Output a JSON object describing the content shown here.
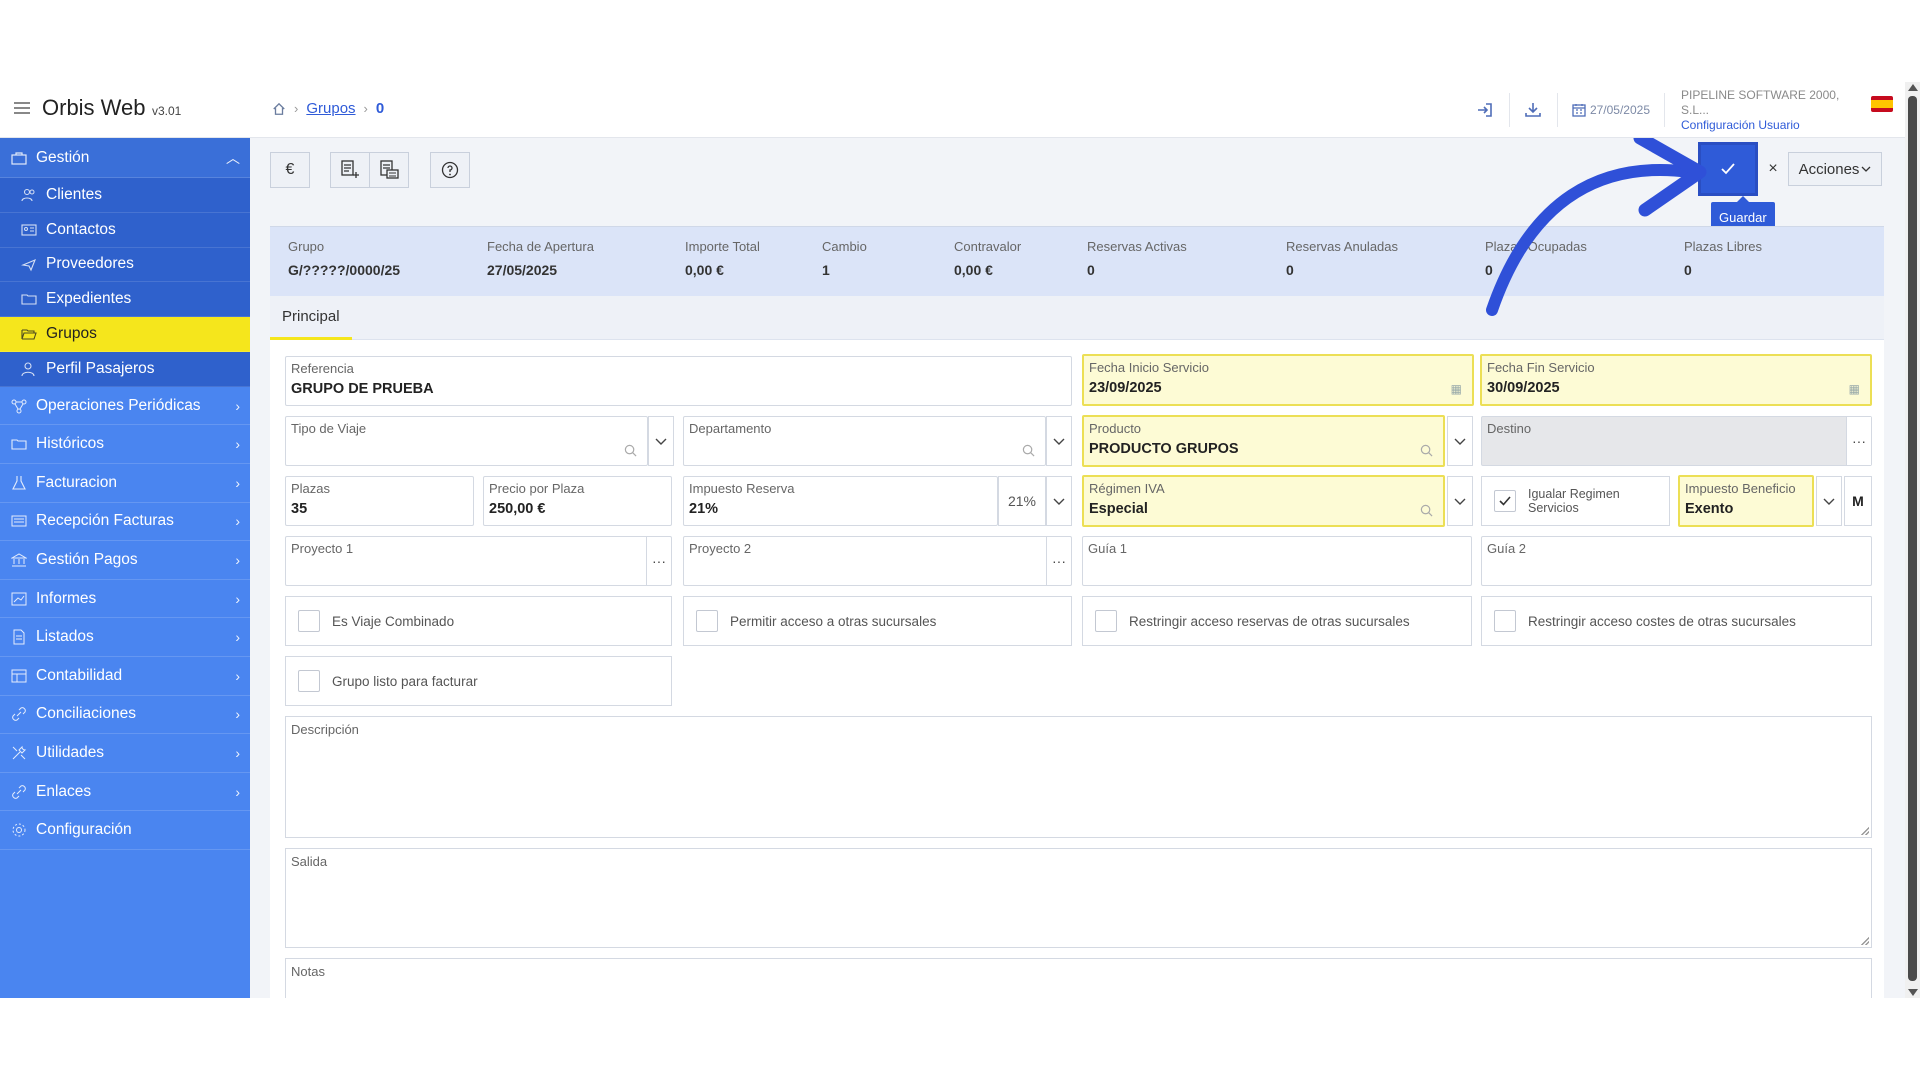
{
  "app": {
    "title": "Orbis Web",
    "version": "v3.01"
  },
  "breadcrumb": {
    "link": "Grupos",
    "current": "0"
  },
  "header": {
    "date": "27/05/2025",
    "company": "PIPELINE SOFTWARE 2000, S.L...",
    "config_link": "Configuración Usuario"
  },
  "sidebar": {
    "section": "Gestión",
    "sub_items": [
      "Clientes",
      "Contactos",
      "Proveedores",
      "Expedientes",
      "Grupos",
      "Perfil Pasajeros"
    ],
    "items": [
      "Operaciones Periódicas",
      "Históricos",
      "Facturacion",
      "Recepción Facturas",
      "Gestión Pagos",
      "Informes",
      "Listados",
      "Contabilidad",
      "Conciliaciones",
      "Utilidades",
      "Enlaces",
      "Configuración"
    ]
  },
  "toolbar": {
    "euro": "€",
    "acciones": "Acciones",
    "close": "×",
    "tooltip": "Guardar"
  },
  "summary": [
    {
      "label": "Grupo",
      "value": "G/?????/0000/25"
    },
    {
      "label": "Fecha de Apertura",
      "value": "27/05/2025"
    },
    {
      "label": "Importe Total",
      "value": "0,00 €"
    },
    {
      "label": "Cambio",
      "value": "1"
    },
    {
      "label": "Contravalor",
      "value": "0,00 €"
    },
    {
      "label": "Reservas Activas",
      "value": "0"
    },
    {
      "label": "Reservas Anuladas",
      "value": "0"
    },
    {
      "label": "Plazas Ocupadas",
      "value": "0"
    },
    {
      "label": "Plazas Libres",
      "value": "0"
    }
  ],
  "tabs": {
    "principal": "Principal"
  },
  "form": {
    "referencia": {
      "label": "Referencia",
      "value": "GRUPO DE PRUEBA"
    },
    "fecha_inicio": {
      "label": "Fecha Inicio Servicio",
      "value": "23/09/2025"
    },
    "fecha_fin": {
      "label": "Fecha Fin Servicio",
      "value": "30/09/2025"
    },
    "tipo_viaje": {
      "label": "Tipo de Viaje",
      "value": ""
    },
    "departamento": {
      "label": "Departamento",
      "value": ""
    },
    "producto": {
      "label": "Producto",
      "value": "PRODUCTO GRUPOS"
    },
    "destino": {
      "label": "Destino",
      "value": ""
    },
    "plazas": {
      "label": "Plazas",
      "value": "35"
    },
    "precio_plaza": {
      "label": "Precio por Plaza",
      "value": "250,00 €"
    },
    "impuesto_reserva": {
      "label": "Impuesto Reserva",
      "value": "21%",
      "pct": "21%"
    },
    "regimen_iva": {
      "label": "Régimen IVA",
      "value": "Especial"
    },
    "igualar_regimen": {
      "label": "Igualar Regimen Servicios",
      "checked": true
    },
    "impuesto_beneficio": {
      "label": "Impuesto Beneficio",
      "value": "Exento",
      "mode": "M"
    },
    "proyecto1": {
      "label": "Proyecto 1",
      "value": ""
    },
    "proyecto2": {
      "label": "Proyecto 2",
      "value": ""
    },
    "guia1": {
      "label": "Guía 1",
      "value": ""
    },
    "guia2": {
      "label": "Guía 2",
      "value": ""
    },
    "es_viaje_combinado": {
      "label": "Es Viaje Combinado",
      "checked": false
    },
    "permitir_acceso": {
      "label": "Permitir acceso a otras sucursales",
      "checked": false
    },
    "restringir_reservas": {
      "label": "Restringir acceso reservas de otras sucursales",
      "checked": false
    },
    "restringir_costes": {
      "label": "Restringir acceso costes de otras sucursales",
      "checked": false
    },
    "grupo_listo": {
      "label": "Grupo listo para facturar",
      "checked": false
    },
    "descripcion": {
      "label": "Descripción"
    },
    "salida": {
      "label": "Salida"
    },
    "notas": {
      "label": "Notas"
    }
  },
  "colors": {
    "sidebar": "#4a85f0",
    "accent": "#2f5bd8",
    "active": "#f5e61c",
    "highlight": "#fdfbd5"
  }
}
